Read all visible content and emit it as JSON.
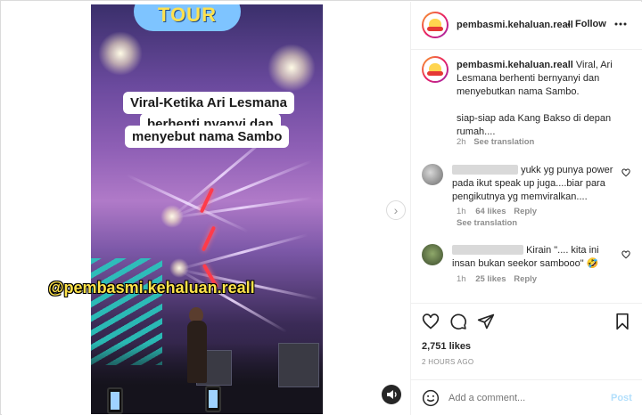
{
  "post": {
    "username": "pembasmi.kehaluan.reall",
    "separator": "•",
    "follow_label": "Follow",
    "more_icon": "more-horizontal-icon",
    "caption_username": "pembasmi.kehaluan.reall",
    "caption_line1": "Viral, Ari",
    "caption_line2": "Lesmana berhenti bernyanyi dan",
    "caption_line3": "menyebutkan nama Sambo.",
    "caption_line4": "siap-siap ada Kang Bakso di depan",
    "caption_line5": "rumah....",
    "caption_time": "2h",
    "caption_translate": "See translation"
  },
  "video": {
    "banner_text": "TOUR",
    "overlay_line1": "Viral-Ketika Ari Lesmana",
    "overlay_line2": "berhenti nyanyi dan",
    "overlay_line3": "menyebut nama Sambo",
    "watermark": "@pembasmi.kehaluan.reall"
  },
  "comments": [
    {
      "text_line1": "yukk yg punya power",
      "text_line2": "pada ikut speak up juga....biar para",
      "text_line3": "pengikutnya yg memviralkan....",
      "time": "1h",
      "likes": "64 likes",
      "reply": "Reply",
      "translate": "See translation"
    },
    {
      "text_line1": "Kirain \".... kita ini",
      "text_line2": "insan bukan seekor sambooo\" 🤣",
      "time": "1h",
      "likes": "25 likes",
      "reply": "Reply"
    }
  ],
  "stats": {
    "likes": "2,751 likes",
    "date": "2 HOURS AGO"
  },
  "compose": {
    "placeholder": "Add a comment...",
    "post_label": "Post"
  },
  "colors": {
    "accent": "#0095f6",
    "post_disabled": "#b2dffc",
    "border": "#dbdbdb"
  }
}
